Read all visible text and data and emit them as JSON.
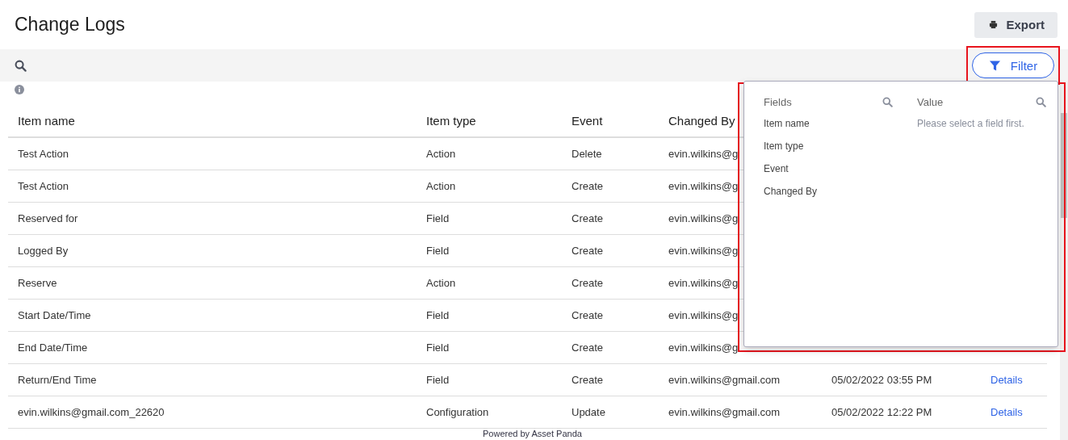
{
  "title": "Change Logs",
  "export_button": "Export",
  "filter_button": "Filter",
  "columns": [
    "Item name",
    "Item type",
    "Event",
    "Changed By"
  ],
  "rows": [
    {
      "item_name": "Test Action",
      "item_type": "Action",
      "event": "Delete",
      "changed_by": "evin.wilkins@g"
    },
    {
      "item_name": "Test Action",
      "item_type": "Action",
      "event": "Create",
      "changed_by": "evin.wilkins@g"
    },
    {
      "item_name": "Reserved for",
      "item_type": "Field",
      "event": "Create",
      "changed_by": "evin.wilkins@g"
    },
    {
      "item_name": "Logged By",
      "item_type": "Field",
      "event": "Create",
      "changed_by": "evin.wilkins@g"
    },
    {
      "item_name": "Reserve",
      "item_type": "Action",
      "event": "Create",
      "changed_by": "evin.wilkins@g"
    },
    {
      "item_name": "Start Date/Time",
      "item_type": "Field",
      "event": "Create",
      "changed_by": "evin.wilkins@g"
    },
    {
      "item_name": "End Date/Time",
      "item_type": "Field",
      "event": "Create",
      "changed_by": "evin.wilkins@g"
    },
    {
      "item_name": "Return/End Time",
      "item_type": "Field",
      "event": "Create",
      "changed_by": "evin.wilkins@gmail.com",
      "date": "05/02/2022 03:55 PM",
      "link": "Details"
    },
    {
      "item_name": "evin.wilkins@gmail.com_22620",
      "item_type": "Configuration",
      "event": "Update",
      "changed_by": "evin.wilkins@gmail.com",
      "date": "05/02/2022 12:22 PM",
      "link": "Details"
    }
  ],
  "filter_panel": {
    "fields_heading": "Fields",
    "value_heading": "Value",
    "fields": [
      "Item name",
      "Item type",
      "Event",
      "Changed By"
    ],
    "value_hint": "Please select a field first."
  },
  "footer": "Powered by Asset Panda"
}
